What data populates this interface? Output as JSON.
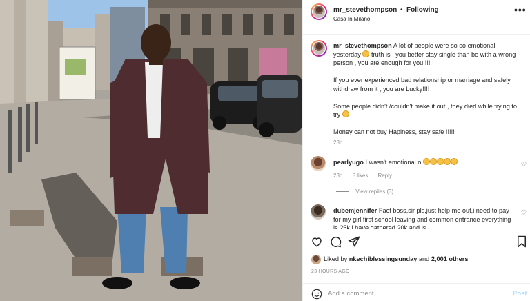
{
  "post": {
    "username": "mr_stevethompson",
    "separator": "•",
    "follow_label": "Following",
    "location": "Casa In Milano!",
    "more_label": "•••"
  },
  "caption": {
    "username": "mr_stevethompson",
    "para1_before_emoji": "A lot of people were so so emotional yesterday",
    "para1_after_emoji": "truth is , you better stay single than be with a wrong person , you are enough for you !!!",
    "para2": "If you ever experienced bad relationship or marriage and safely withdraw from it , you are Lucky!!!!",
    "para3": "Some people didn't /couldn't make it out , they died while trying to try",
    "para4": "Money can not buy Hapiness, stay safe !!!!!",
    "time": "23h"
  },
  "comments": [
    {
      "username": "pearlyugo",
      "text": "I wasn't emotional o",
      "time": "23h",
      "likes": "5 likes",
      "reply_label": "Reply",
      "view_replies": "View replies (3)"
    },
    {
      "username": "dubemjennifer",
      "text": "Fact boss,sir pls,just help me out,i need to pay for my girl first school leaving and common entrance everything is 25k i have gathered 20k and is"
    }
  ],
  "likes": {
    "prefix": "Liked by",
    "user": "nkechiblessingsunday",
    "and": "and",
    "others": "2,001 others"
  },
  "timestamp": "23 HOURS AGO",
  "composer": {
    "placeholder": "Add a comment...",
    "post_label": "Post"
  },
  "icons": {
    "like": "heart-icon",
    "comment": "comment-icon",
    "share": "share-icon",
    "save": "bookmark-icon",
    "emoji": "smile-icon"
  },
  "colors": {
    "post_button": "#b2dffc",
    "secondary_text": "#8e8e8e",
    "primary_text": "#262626"
  }
}
